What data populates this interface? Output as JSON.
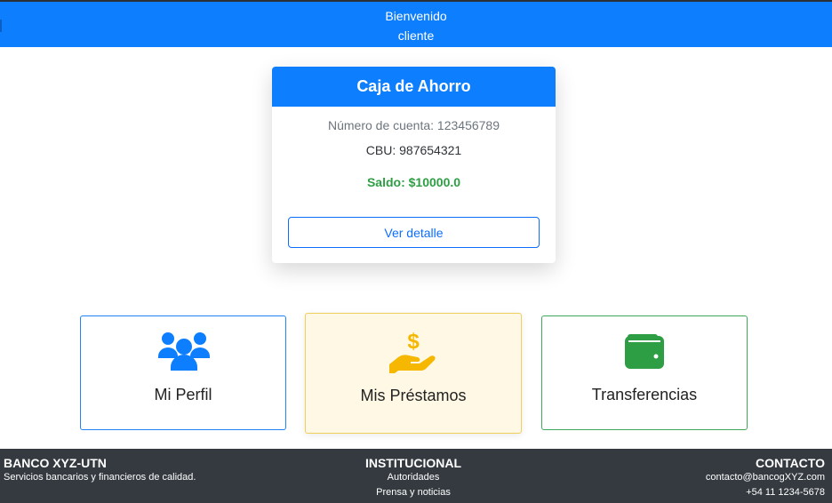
{
  "header": {
    "line1": "Bienvenido",
    "line2": "cliente"
  },
  "account_card": {
    "title": "Caja de Ahorro",
    "account_number": "Número de cuenta: 123456789",
    "cbu": "CBU: 987654321",
    "balance": "Saldo: $10000.0",
    "detail_button": "Ver detalle"
  },
  "tiles": {
    "profile": {
      "label": "Mi Perfil",
      "icon": "users-icon"
    },
    "loans": {
      "label": "Mis Préstamos",
      "icon": "hand-dollar-icon"
    },
    "transfers": {
      "label": "Transferencias",
      "icon": "wallet-icon"
    }
  },
  "footer": {
    "brand": "BANCO XYZ-UTN",
    "tagline": "Servicios bancarios y financieros de calidad.",
    "institutional_title": "INSTITUCIONAL",
    "institutional_links": [
      "Autoridades",
      "Prensa y noticias"
    ],
    "contact_title": "CONTACTO",
    "email": "contacto@bancogXYZ.com",
    "phone": "+54 11 1234-5678"
  },
  "colors": {
    "primary": "#0d7efd",
    "success": "#2e9e45",
    "warning": "#f5b700",
    "footer": "#343a40"
  }
}
